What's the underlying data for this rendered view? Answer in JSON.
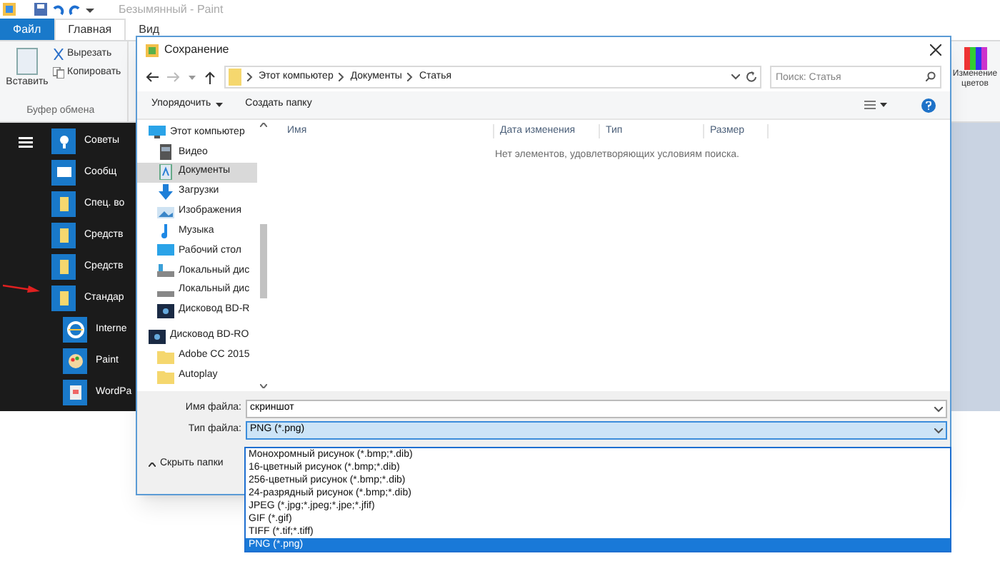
{
  "paint": {
    "title": "Безымянный - Paint",
    "ribbon_tabs": [
      {
        "label": "Файл",
        "kind": "file"
      },
      {
        "label": "Главная",
        "selected": true,
        "kind": "tab"
      },
      {
        "label": "Вид",
        "selected": false,
        "kind": "tab"
      }
    ],
    "paste": "Вставить",
    "cut": "Вырезать",
    "copy": "Копировать",
    "clipboard_group": "Буфер обмена",
    "colors_button": "Изменение цветов"
  },
  "start_menu": {
    "items": [
      {
        "label": "Советы",
        "kind": "tips"
      },
      {
        "label": "Сообщ",
        "kind": "message"
      },
      {
        "label": "Спец. во",
        "kind": "folder"
      },
      {
        "label": "Средств",
        "kind": "folder"
      },
      {
        "label": "Средств",
        "kind": "folder"
      },
      {
        "label": "Стандар",
        "kind": "folder",
        "expanded": true,
        "children": [
          {
            "label": "Interne",
            "kind": "ie"
          },
          {
            "label": "Paint",
            "kind": "paint"
          },
          {
            "label": "WordPa",
            "kind": "wordpad"
          }
        ]
      }
    ]
  },
  "dialog": {
    "title": "Сохранение",
    "breadcrumb": [
      "Этот компьютер",
      "Документы",
      "Статья"
    ],
    "search": {
      "placeholder": "Поиск: Статья"
    },
    "toolbar": {
      "organize": "Упорядочить",
      "new_folder": "Создать папку"
    },
    "nav": [
      {
        "label": "Этот компьютер",
        "kind": "pc",
        "selected": false,
        "children": [
          {
            "label": "Видео",
            "kind": "video",
            "selected": false
          },
          {
            "label": "Документы",
            "kind": "docs",
            "selected": true
          },
          {
            "label": "Загрузки",
            "kind": "download",
            "selected": false
          },
          {
            "label": "Изображения",
            "kind": "images",
            "selected": false
          },
          {
            "label": "Музыка",
            "kind": "music",
            "selected": false
          },
          {
            "label": "Рабочий стол",
            "kind": "desktop",
            "selected": false
          },
          {
            "label": "Локальный дис",
            "kind": "disk",
            "selected": false
          },
          {
            "label": "Локальный дис",
            "kind": "disk2",
            "selected": false
          },
          {
            "label": "Дисковод BD-R",
            "kind": "bd",
            "selected": false
          }
        ]
      },
      {
        "label": "Дисковод BD-RO",
        "kind": "bd",
        "selected": false,
        "children": [
          {
            "label": "Adobe CC 2015",
            "kind": "folder",
            "selected": false
          },
          {
            "label": "Autoplay",
            "kind": "folder",
            "selected": false
          }
        ]
      }
    ],
    "columns": [
      "Имя",
      "Дата изменения",
      "Тип",
      "Размер"
    ],
    "empty_message": "Нет элементов, удовлетворяющих условиям поиска.",
    "file_name": {
      "label": "Имя файла:",
      "value": "скриншот"
    },
    "file_type": {
      "label": "Тип файла:",
      "value": "PNG (*.png)",
      "expanded": true
    },
    "type_options": [
      {
        "label": "Монохромный рисунок (*.bmp;*.dib)",
        "selected": false
      },
      {
        "label": "16-цветный рисунок (*.bmp;*.dib)",
        "selected": false
      },
      {
        "label": "256-цветный рисунок (*.bmp;*.dib)",
        "selected": false
      },
      {
        "label": "24-разрядный рисунок (*.bmp;*.dib)",
        "selected": false
      },
      {
        "label": "JPEG (*.jpg;*.jpeg;*.jpe;*.jfif)",
        "selected": false
      },
      {
        "label": "GIF (*.gif)",
        "selected": false
      },
      {
        "label": "TIFF (*.tif;*.tiff)",
        "selected": false
      },
      {
        "label": "PNG (*.png)",
        "selected": true
      }
    ],
    "hide_folders": "Скрыть папки"
  }
}
